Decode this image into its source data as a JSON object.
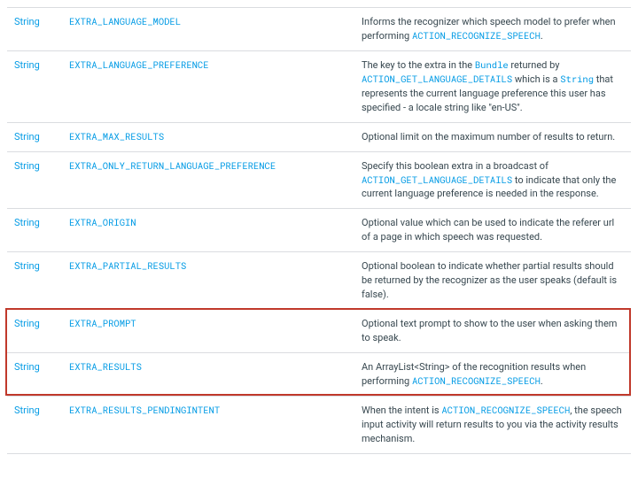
{
  "type_label": "String",
  "string_type_link": "String",
  "rows": [
    {
      "const": "EXTRA_LANGUAGE_MODEL",
      "desc_prefix": "Informs the recognizer which speech model to prefer when performing ",
      "link1": "ACTION_RECOGNIZE_SPEECH",
      "desc_suffix": "."
    },
    {
      "const": "EXTRA_LANGUAGE_PREFERENCE",
      "desc_p1": "The key to the extra in the ",
      "link_bundle": "Bundle",
      "desc_p2": " returned by ",
      "link_action": "ACTION_GET_LANGUAGE_DETAILS",
      "desc_p3": " which is a ",
      "link_string": "String",
      "desc_p4": " that represents the current language preference this user has specified - a locale string like \"en-US\"."
    },
    {
      "const": "EXTRA_MAX_RESULTS",
      "desc": "Optional limit on the maximum number of results to return."
    },
    {
      "const": "EXTRA_ONLY_RETURN_LANGUAGE_PREFERENCE",
      "desc_p1": "Specify this boolean extra in a broadcast of ",
      "link1": "ACTION_GET_LANGUAGE_DETAILS",
      "desc_p2": " to indicate that only the current language preference is needed in the response."
    },
    {
      "const": "EXTRA_ORIGIN",
      "desc": "Optional value which can be used to indicate the referer url of a page in which speech was requested."
    },
    {
      "const": "EXTRA_PARTIAL_RESULTS",
      "desc": "Optional boolean to indicate whether partial results should be returned by the recognizer as the user speaks (default is false)."
    },
    {
      "const": "EXTRA_PROMPT",
      "desc": "Optional text prompt to show to the user when asking them to speak."
    },
    {
      "const": "EXTRA_RESULTS",
      "desc_p1": "An ArrayList<String> of the recognition results when performing ",
      "link1": "ACTION_RECOGNIZE_SPEECH",
      "desc_p2": "."
    },
    {
      "const": "EXTRA_RESULTS_PENDINGINTENT",
      "desc_p1": "When the intent is ",
      "link1": "ACTION_RECOGNIZE_SPEECH",
      "desc_p2": ", the speech input activity will return results to you via the activity results mechanism."
    }
  ]
}
